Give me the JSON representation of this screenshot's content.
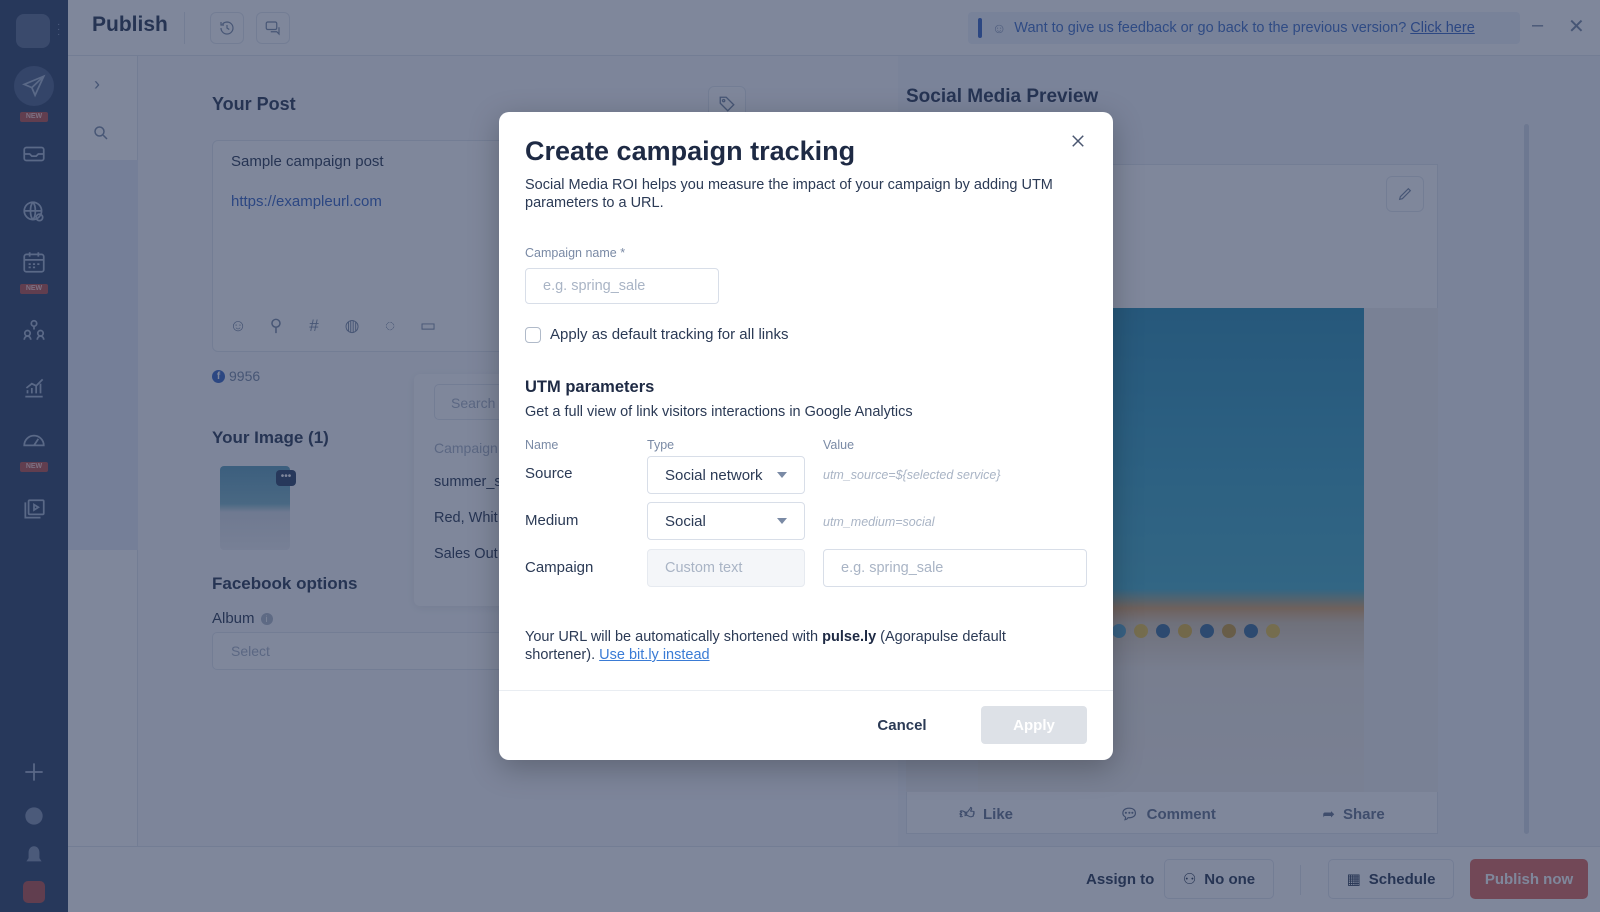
{
  "app": {
    "title": "Publish",
    "feedback_text": "Want to give us feedback or go back to the previous version?",
    "feedback_link": "Click here",
    "new_badge": "NEW"
  },
  "compose": {
    "your_post_heading": "Your Post",
    "post_text": "Sample campaign post",
    "post_link": "https://exampleurl.com",
    "char_count": "9956",
    "your_image_heading": "Your Image (1)",
    "facebook_options_heading": "Facebook options",
    "album_label": "Album",
    "album_placeholder": "Select",
    "campaign_dropdown": {
      "search_placeholder": "Search",
      "header": "Campaign",
      "options": [
        "summer_s",
        "Red, Whit",
        "Sales Out"
      ]
    }
  },
  "preview": {
    "heading": "Social Media Preview",
    "actions": [
      "Like",
      "Comment",
      "Share"
    ]
  },
  "footer": {
    "assign_label": "Assign to",
    "assignee": "No one",
    "schedule_label": "Schedule",
    "publish_label": "Publish now"
  },
  "modal": {
    "title": "Create campaign tracking",
    "subtitle": "Social Media ROI helps you measure the impact of your campaign by adding UTM parameters to a URL.",
    "campaign_name_label": "Campaign name *",
    "campaign_name_placeholder": "e.g. spring_sale",
    "default_tracking_label": "Apply as default tracking for all links",
    "default_tracking_checked": false,
    "utm_heading": "UTM parameters",
    "utm_subheading": "Get a full view of link visitors interactions in Google Analytics",
    "columns": {
      "name": "Name",
      "type": "Type",
      "value": "Value"
    },
    "rows": [
      {
        "name": "Source",
        "type": "Social network",
        "value_hint": "utm_source=${selected service}"
      },
      {
        "name": "Medium",
        "type": "Social",
        "value_hint": "utm_medium=social"
      },
      {
        "name": "Campaign",
        "type_placeholder": "Custom text",
        "value_placeholder": "e.g. spring_sale"
      }
    ],
    "note_prefix": "Your URL will be automatically shortened with",
    "note_bold": "pulse.ly",
    "note_suffix": "(Agorapulse default shortener).",
    "note_link": "Use bit.ly instead",
    "cancel_label": "Cancel",
    "apply_label": "Apply"
  },
  "colors": {
    "rail": "#2f4368",
    "accent_link": "#3a7bd5",
    "publish": "#e06a5e",
    "apply_disabled": "#dde1e7"
  }
}
